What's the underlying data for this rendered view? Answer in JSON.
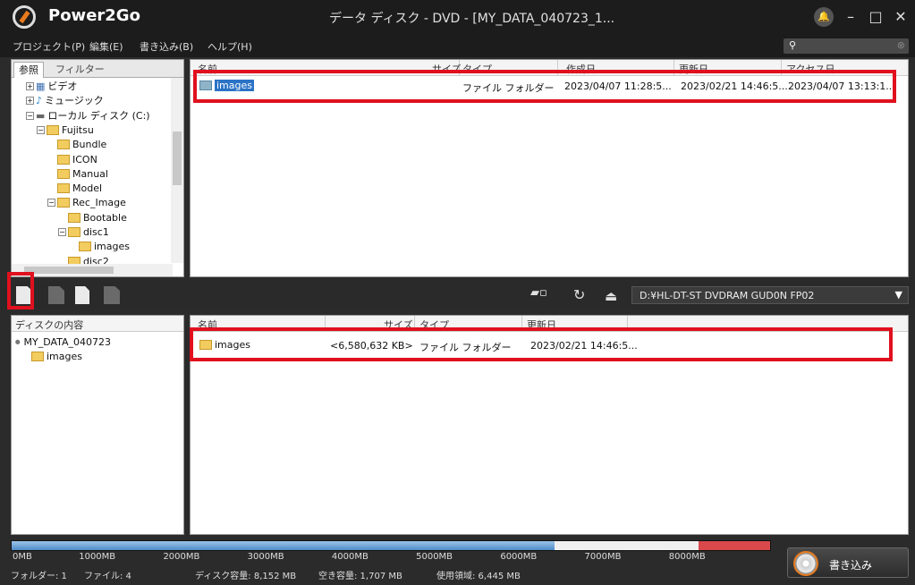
{
  "app": {
    "name": "Power2Go",
    "window_title": "データ ディスク - DVD - [MY_DATA_040723_1..."
  },
  "menu": [
    "プロジェクト(P)",
    "編集(E)",
    "書き込み(B)",
    "ヘルプ(H)"
  ],
  "search": {
    "placeholder": "",
    "icon": "search-icon"
  },
  "browser": {
    "tabs": [
      "参照",
      "フィルター"
    ],
    "tree": [
      {
        "label": "ビデオ",
        "indent": 1
      },
      {
        "label": "ミュージック",
        "indent": 1
      },
      {
        "label": "ローカル ディスク (C:)",
        "indent": 1
      },
      {
        "label": "Fujitsu",
        "indent": 2
      },
      {
        "label": "Bundle",
        "indent": 3
      },
      {
        "label": "ICON",
        "indent": 3
      },
      {
        "label": "Manual",
        "indent": 3
      },
      {
        "label": "Model",
        "indent": 3
      },
      {
        "label": "Rec_Image",
        "indent": 3
      },
      {
        "label": "Bootable",
        "indent": 4
      },
      {
        "label": "disc1",
        "indent": 4
      },
      {
        "label": "images",
        "indent": 5
      },
      {
        "label": "disc2",
        "indent": 4
      }
    ],
    "columns": [
      "名前",
      "サイズ",
      "タイプ",
      "作成日",
      "更新日",
      "アクセス日"
    ],
    "rows": [
      {
        "name": "images",
        "size": "",
        "type": "ファイル フォルダー",
        "created": "2023/04/07 11:28:5...",
        "modified": "2023/02/21 14:46:5...",
        "accessed": "2023/04/07 13:13:1..."
      }
    ]
  },
  "drive": {
    "label": "D:¥HL-DT-ST DVDRAM GUD0N FP02"
  },
  "disc": {
    "panel_title": "ディスクの内容",
    "tree": [
      {
        "label": "MY_DATA_040723",
        "indent": 0
      },
      {
        "label": "images",
        "indent": 1
      }
    ],
    "columns": [
      "名前",
      "サイズ",
      "タイプ",
      "更新日"
    ],
    "rows": [
      {
        "name": "images",
        "size": "<6,580,632 KB>",
        "type": "ファイル フォルダー",
        "modified": "2023/02/21 14:46:5..."
      }
    ]
  },
  "capacity": {
    "ticks": [
      "0MB",
      "1000MB",
      "2000MB",
      "3000MB",
      "4000MB",
      "5000MB",
      "6000MB",
      "7000MB",
      "8000MB"
    ],
    "used_mb": 6445,
    "disc_mb": 8152,
    "max_mb": 9000,
    "colors": {
      "used": "#4f8cc8",
      "free": "#f0f0f0",
      "over": "#d9484b"
    }
  },
  "status": {
    "folders": "フォルダー: 1",
    "files": "ファイル: 4",
    "disc_capacity": "ディスク容量: 8,152 MB",
    "free_space": "空き容量: 1,707 MB",
    "used_space": "使用領域: 6,445 MB"
  },
  "burn_button": {
    "label": "書き込み"
  },
  "highlight_color": "#e0101e"
}
